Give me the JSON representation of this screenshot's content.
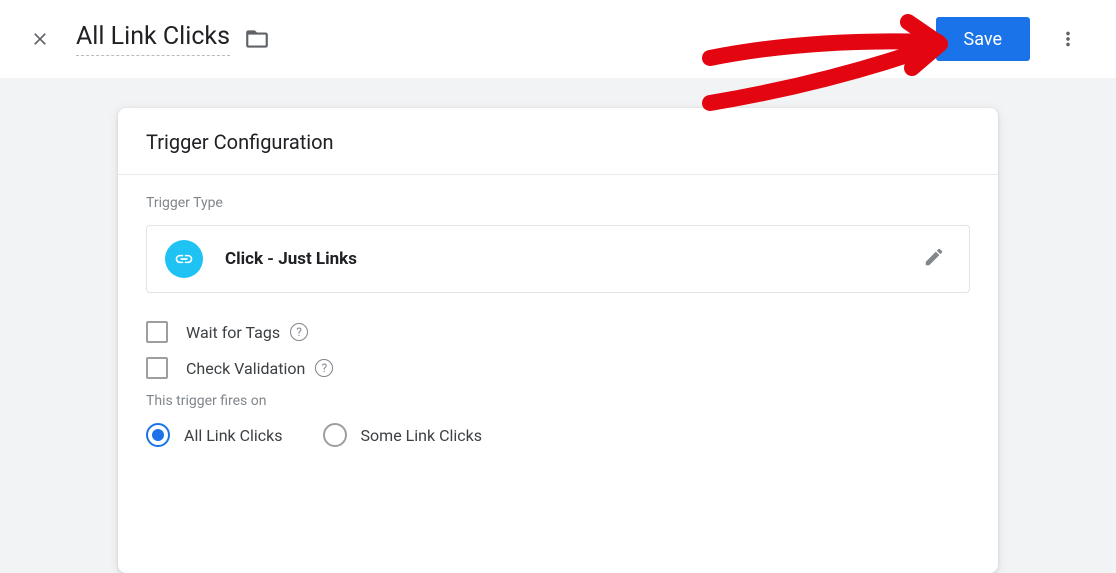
{
  "header": {
    "title": "All Link Clicks",
    "save_label": "Save"
  },
  "card": {
    "title": "Trigger Configuration",
    "type_label": "Trigger Type",
    "type_value": "Click - Just Links",
    "wait_label": "Wait for Tags",
    "validation_label": "Check Validation",
    "fires_label": "This trigger fires on",
    "radio_all": "All Link Clicks",
    "radio_some": "Some Link Clicks"
  }
}
